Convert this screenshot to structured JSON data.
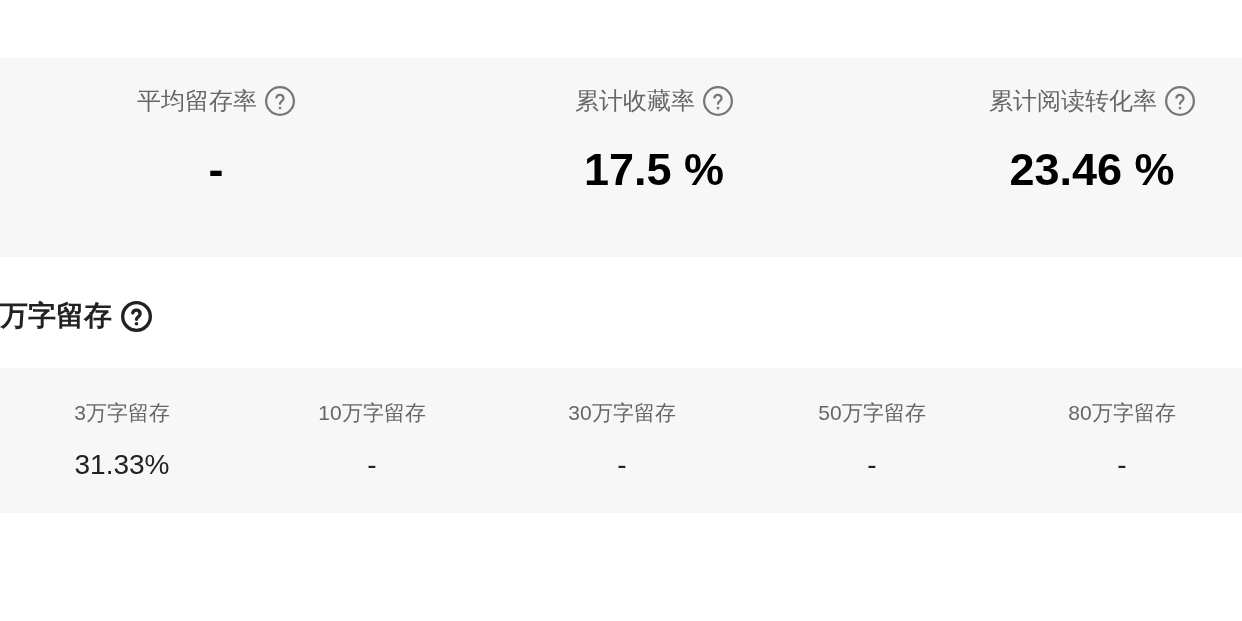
{
  "summary_metrics": [
    {
      "label": "平均留存率",
      "value": "-"
    },
    {
      "label": "累计收藏率",
      "value": "17.5 %"
    },
    {
      "label": "累计阅读转化率",
      "value": "23.46 %"
    }
  ],
  "retention_section": {
    "title": "万字留存",
    "metrics": [
      {
        "label": "3万字留存",
        "value": "31.33%"
      },
      {
        "label": "10万字留存",
        "value": "-"
      },
      {
        "label": "30万字留存",
        "value": "-"
      },
      {
        "label": "50万字留存",
        "value": "-"
      },
      {
        "label": "80万字留存",
        "value": "-"
      }
    ]
  }
}
